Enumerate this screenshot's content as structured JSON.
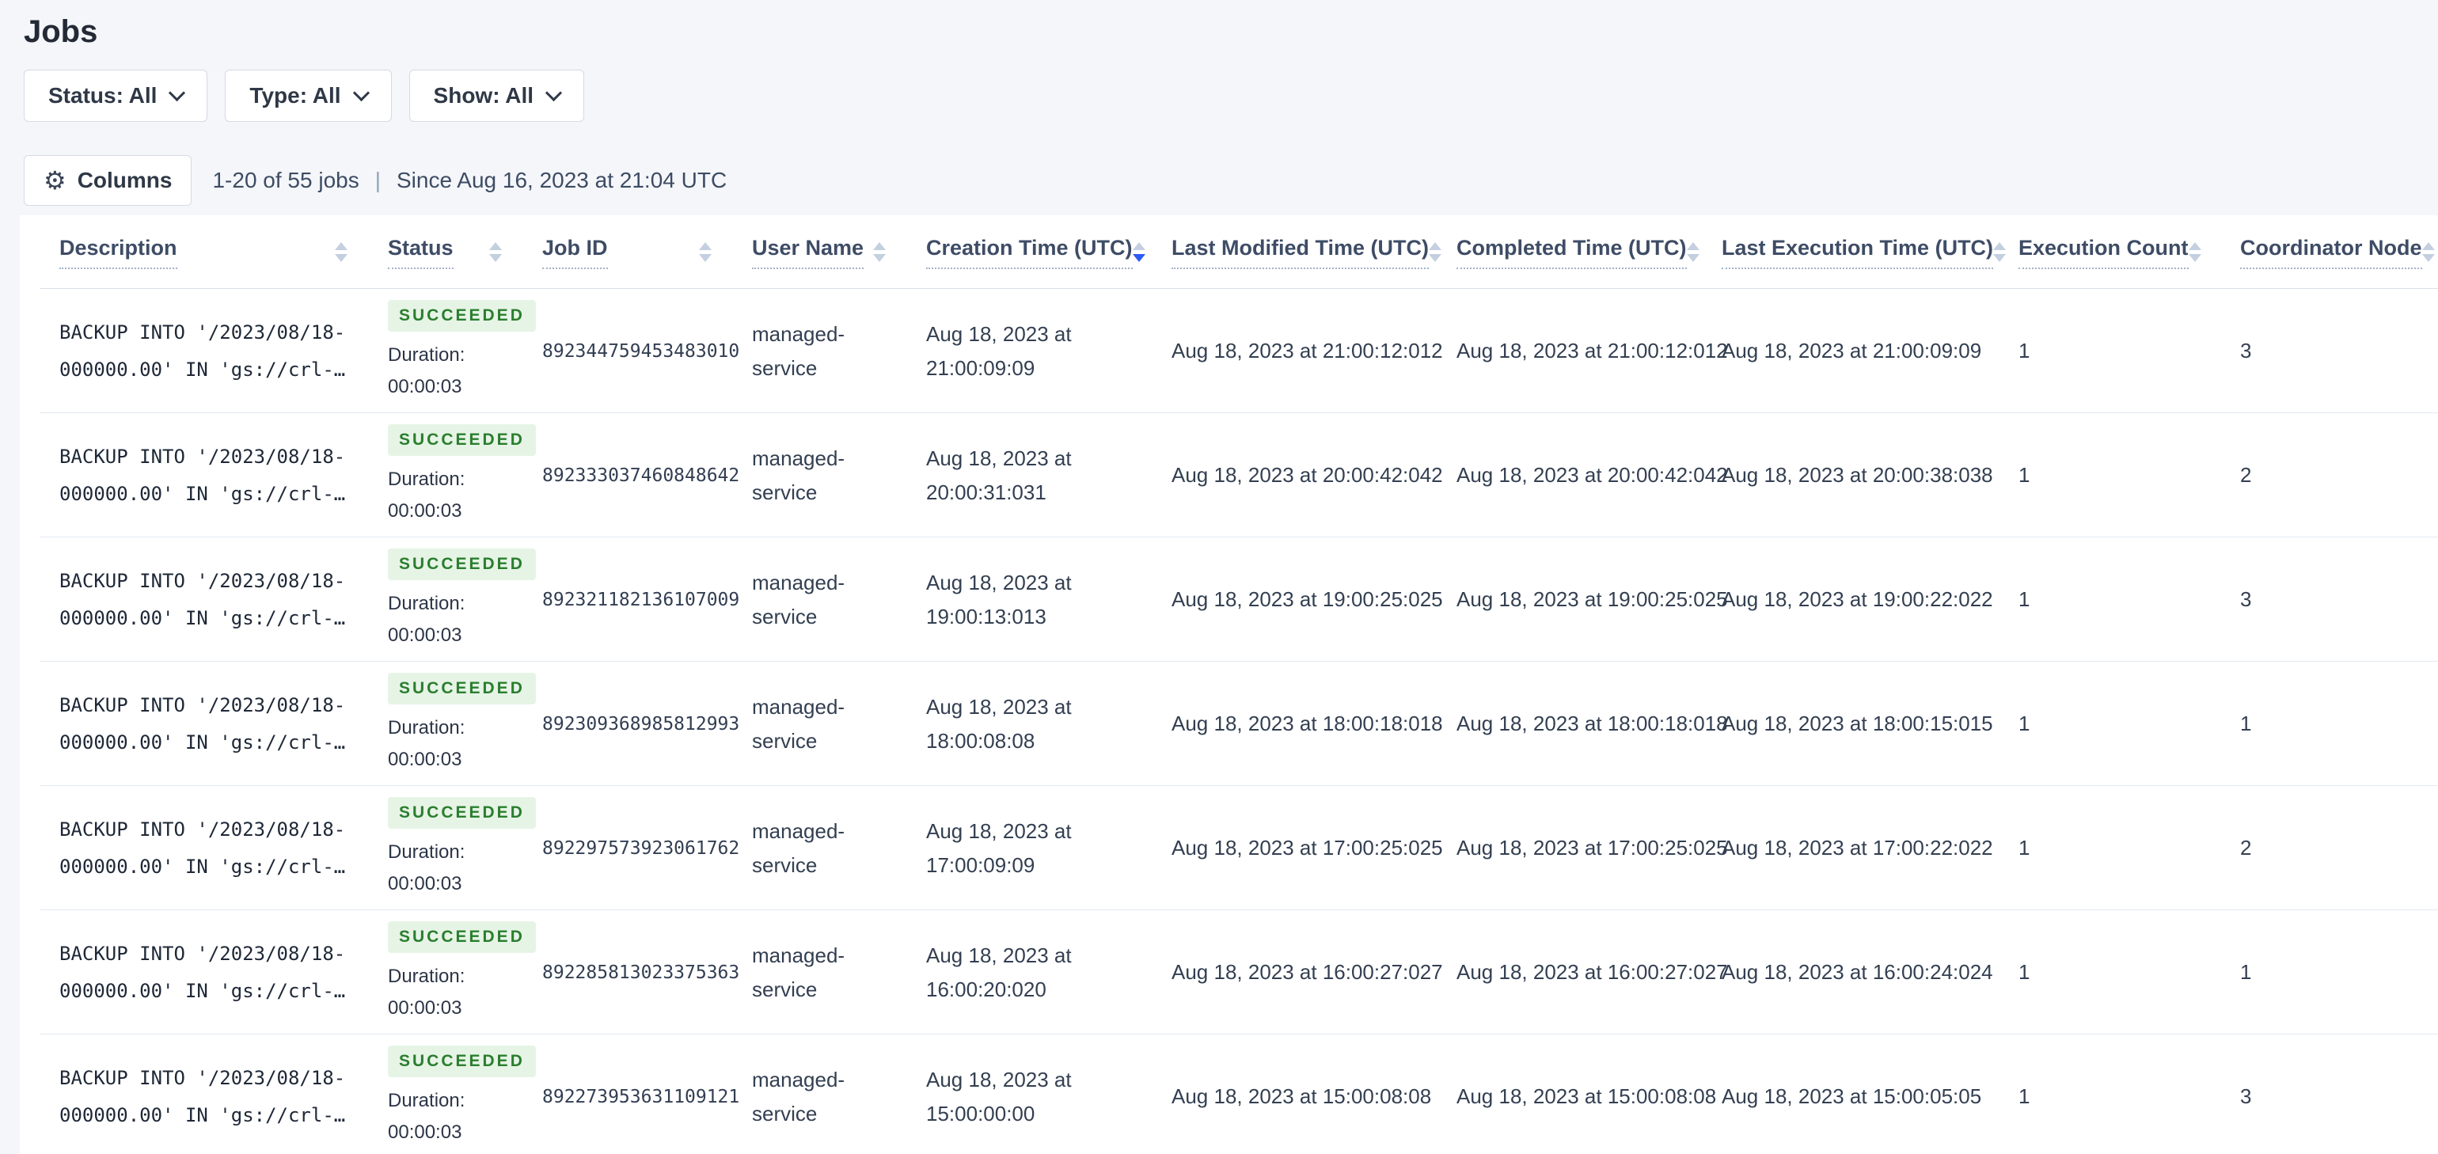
{
  "page": {
    "title": "Jobs"
  },
  "filters": {
    "status": "Status: All",
    "type": "Type: All",
    "show": "Show: All"
  },
  "toolbar": {
    "columns_label": "Columns",
    "gear_icon": "gear-icon",
    "jobs_count": "1-20 of 55 jobs",
    "separator": "|",
    "since": "Since Aug 16, 2023 at 21:04 UTC"
  },
  "colors": {
    "page_bg": "#f4f6fa",
    "sort_active": "#2b5bf7",
    "badge_bg": "#e6f4e6",
    "badge_text": "#2a7e2e"
  },
  "sort": {
    "column": "creation_time",
    "direction": "desc"
  },
  "table": {
    "columns": [
      {
        "field": "description",
        "label": "Description"
      },
      {
        "field": "status",
        "label": "Status"
      },
      {
        "field": "job_id",
        "label": "Job ID"
      },
      {
        "field": "user_name",
        "label": "User Name"
      },
      {
        "field": "creation_time",
        "label": "Creation Time (UTC)"
      },
      {
        "field": "last_modified_time",
        "label": "Last Modified Time (UTC)"
      },
      {
        "field": "completed_time",
        "label": "Completed Time (UTC)"
      },
      {
        "field": "last_execution_time",
        "label": "Last Execution Time (UTC)"
      },
      {
        "field": "execution_count",
        "label": "Execution Count"
      },
      {
        "field": "coordinator_node",
        "label": "Coordinator Node"
      }
    ],
    "rows": [
      {
        "description": "BACKUP INTO '/2023/08/18-000000.00' IN 'gs://crl-…",
        "status": "SUCCEEDED",
        "duration_label": "Duration:",
        "duration": "00:00:03",
        "job_id": "892344759453483010",
        "user_name": "managed-service",
        "creation_time": "Aug 18, 2023 at 21:00:09:09",
        "last_modified_time": "Aug 18, 2023 at 21:00:12:012",
        "completed_time": "Aug 18, 2023 at 21:00:12:012",
        "last_execution_time": "Aug 18, 2023 at 21:00:09:09",
        "execution_count": "1",
        "coordinator_node": "3"
      },
      {
        "description": "BACKUP INTO '/2023/08/18-000000.00' IN 'gs://crl-…",
        "status": "SUCCEEDED",
        "duration_label": "Duration:",
        "duration": "00:00:03",
        "job_id": "892333037460848642",
        "user_name": "managed-service",
        "creation_time": "Aug 18, 2023 at 20:00:31:031",
        "last_modified_time": "Aug 18, 2023 at 20:00:42:042",
        "completed_time": "Aug 18, 2023 at 20:00:42:042",
        "last_execution_time": "Aug 18, 2023 at 20:00:38:038",
        "execution_count": "1",
        "coordinator_node": "2"
      },
      {
        "description": "BACKUP INTO '/2023/08/18-000000.00' IN 'gs://crl-…",
        "status": "SUCCEEDED",
        "duration_label": "Duration:",
        "duration": "00:00:03",
        "job_id": "892321182136107009",
        "user_name": "managed-service",
        "creation_time": "Aug 18, 2023 at 19:00:13:013",
        "last_modified_time": "Aug 18, 2023 at 19:00:25:025",
        "completed_time": "Aug 18, 2023 at 19:00:25:025",
        "last_execution_time": "Aug 18, 2023 at 19:00:22:022",
        "execution_count": "1",
        "coordinator_node": "3"
      },
      {
        "description": "BACKUP INTO '/2023/08/18-000000.00' IN 'gs://crl-…",
        "status": "SUCCEEDED",
        "duration_label": "Duration:",
        "duration": "00:00:03",
        "job_id": "892309368985812993",
        "user_name": "managed-service",
        "creation_time": "Aug 18, 2023 at 18:00:08:08",
        "last_modified_time": "Aug 18, 2023 at 18:00:18:018",
        "completed_time": "Aug 18, 2023 at 18:00:18:018",
        "last_execution_time": "Aug 18, 2023 at 18:00:15:015",
        "execution_count": "1",
        "coordinator_node": "1"
      },
      {
        "description": "BACKUP INTO '/2023/08/18-000000.00' IN 'gs://crl-…",
        "status": "SUCCEEDED",
        "duration_label": "Duration:",
        "duration": "00:00:03",
        "job_id": "892297573923061762",
        "user_name": "managed-service",
        "creation_time": "Aug 18, 2023 at 17:00:09:09",
        "last_modified_time": "Aug 18, 2023 at 17:00:25:025",
        "completed_time": "Aug 18, 2023 at 17:00:25:025",
        "last_execution_time": "Aug 18, 2023 at 17:00:22:022",
        "execution_count": "1",
        "coordinator_node": "2"
      },
      {
        "description": "BACKUP INTO '/2023/08/18-000000.00' IN 'gs://crl-…",
        "status": "SUCCEEDED",
        "duration_label": "Duration:",
        "duration": "00:00:03",
        "job_id": "892285813023375363",
        "user_name": "managed-service",
        "creation_time": "Aug 18, 2023 at 16:00:20:020",
        "last_modified_time": "Aug 18, 2023 at 16:00:27:027",
        "completed_time": "Aug 18, 2023 at 16:00:27:027",
        "last_execution_time": "Aug 18, 2023 at 16:00:24:024",
        "execution_count": "1",
        "coordinator_node": "1"
      },
      {
        "description": "BACKUP INTO '/2023/08/18-000000.00' IN 'gs://crl-…",
        "status": "SUCCEEDED",
        "duration_label": "Duration:",
        "duration": "00:00:03",
        "job_id": "892273953631109121",
        "user_name": "managed-service",
        "creation_time": "Aug 18, 2023 at 15:00:00:00",
        "last_modified_time": "Aug 18, 2023 at 15:00:08:08",
        "completed_time": "Aug 18, 2023 at 15:00:08:08",
        "last_execution_time": "Aug 18, 2023 at 15:00:05:05",
        "execution_count": "1",
        "coordinator_node": "3"
      }
    ]
  }
}
